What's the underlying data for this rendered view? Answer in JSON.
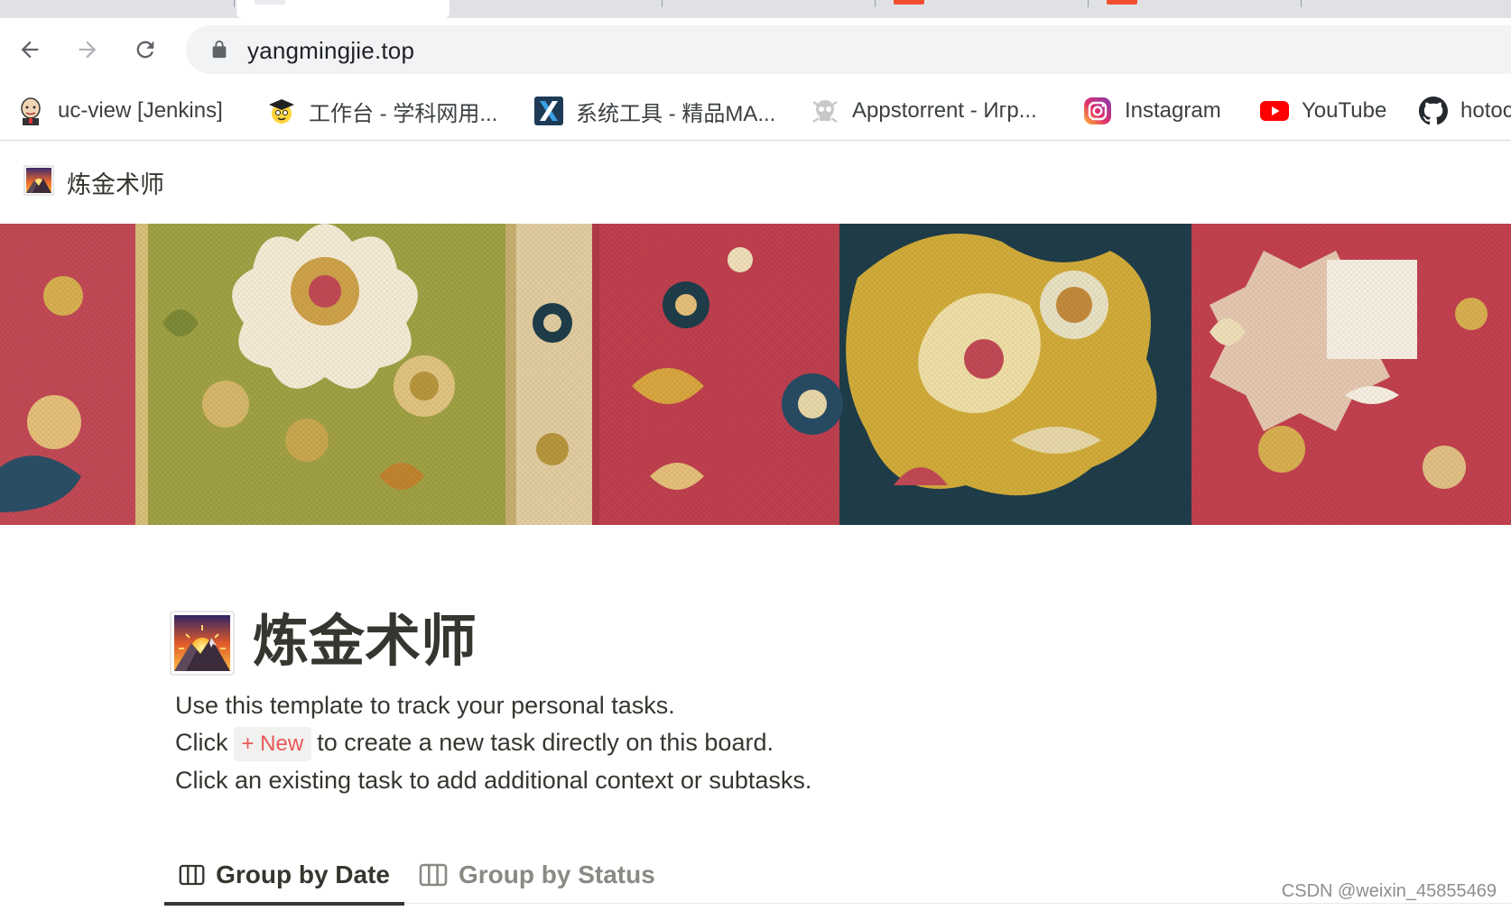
{
  "browser": {
    "url": "yangmingjie.top",
    "bookmarks": [
      {
        "label": "uc-view [Jenkins]",
        "icon": "jenkins-butler-icon"
      },
      {
        "label": "工作台 - 学科网用...",
        "icon": "graduate-emoji-icon"
      },
      {
        "label": "系统工具 - 精品MA...",
        "icon": "x-logo-icon"
      },
      {
        "label": "Appstorrent - Игр...",
        "icon": "skull-icon"
      },
      {
        "label": "Instagram",
        "icon": "instagram-icon"
      },
      {
        "label": "YouTube",
        "icon": "youtube-icon"
      },
      {
        "label": "hotoc",
        "icon": "github-icon"
      }
    ],
    "colors": {
      "tabstrip": "#dfe1e5",
      "omnibox": "#f1f3f4",
      "youtube": "#ff0000"
    }
  },
  "page": {
    "breadcrumb_title": "炼金术师",
    "title": "炼金术师",
    "icon": "sunrise-over-mountains-icon",
    "cover": "persian-carpet-cover",
    "description": {
      "line1": "Use this template to track your personal tasks.",
      "line2_before": "Click",
      "new_chip": "+ New",
      "line2_after": "to create a new task directly on this board.",
      "line3": "Click an existing task to add additional context or subtasks."
    },
    "views": [
      {
        "label": "Group by Date",
        "active": true,
        "icon": "board-icon"
      },
      {
        "label": "Group by Status",
        "active": false,
        "icon": "board-icon"
      }
    ],
    "colors": {
      "text": "#37352f",
      "new_chip_text": "#eb5757",
      "new_chip_bg": "#f1f1ef"
    }
  },
  "watermark": "CSDN @weixin_45855469"
}
